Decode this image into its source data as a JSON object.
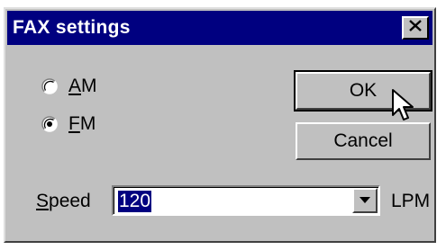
{
  "window": {
    "title": "FAX settings"
  },
  "modes": [
    {
      "key": "A",
      "rest": "M",
      "selected": false
    },
    {
      "key": "F",
      "rest": "M",
      "selected": true
    }
  ],
  "buttons": {
    "ok": "OK",
    "cancel": "Cancel"
  },
  "speed": {
    "key": "S",
    "rest": "peed",
    "value": "120",
    "unit": "LPM"
  },
  "icons": {
    "close": "close-icon",
    "dropdown": "chevron-down-icon",
    "pointer": "mouse-pointer-icon"
  },
  "colors": {
    "titlebar": "#000080",
    "face": "#c0c0c0",
    "selection": "#000080"
  }
}
